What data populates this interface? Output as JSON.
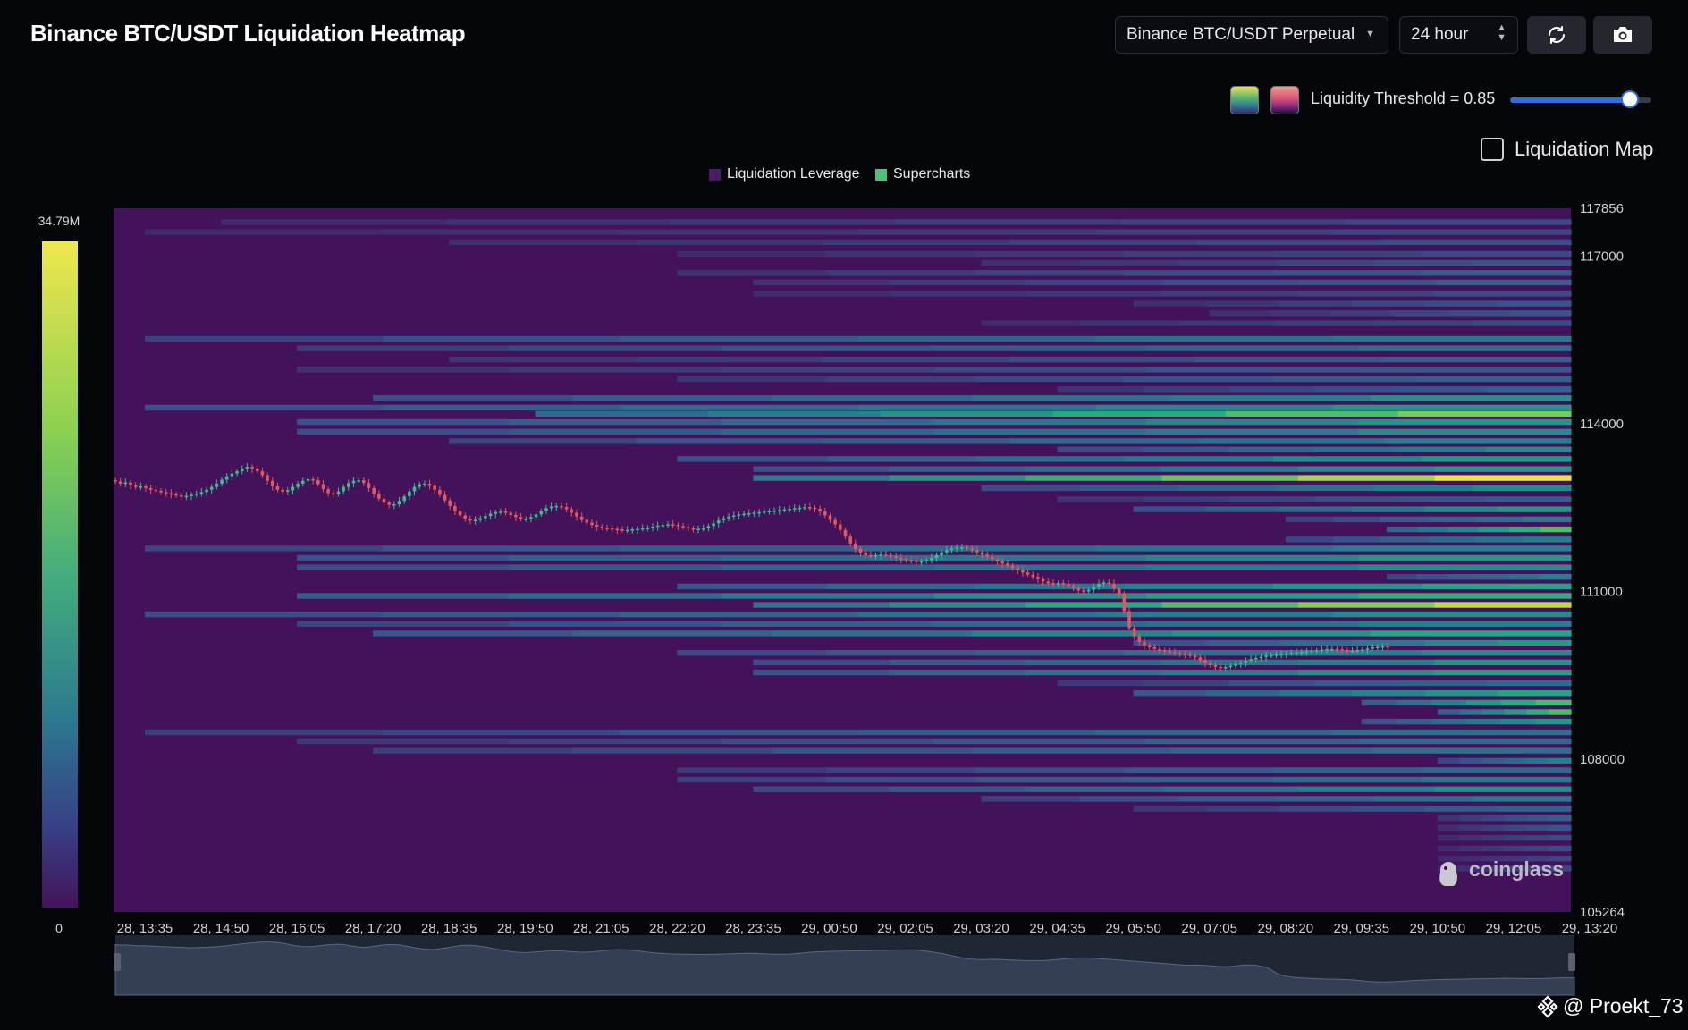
{
  "header": {
    "title": "Binance BTC/USDT Liquidation Heatmap",
    "pair_select": "Binance BTC/USDT Perpetual",
    "range_select": "24 hour"
  },
  "controls": {
    "threshold_label": "Liquidity Threshold = 0.85",
    "threshold_value": 0.85,
    "liquidation_map_label": "Liquidation Map",
    "liquidation_map_checked": false,
    "palettes": [
      "viridis",
      "magma"
    ]
  },
  "colors": {
    "background": "#05060a",
    "heatmap_base": "#43125a",
    "up_candle": "#3dbd8e",
    "down_candle": "#e5575e",
    "accent": "#2f6fe0"
  },
  "colorbar": {
    "max_label": "34.79M",
    "min_label": "0"
  },
  "watermark": {
    "brand": "coinglass",
    "handle": "@ Proekt_73"
  },
  "chart_data": {
    "type": "heatmap",
    "title": "Binance BTC/USDT Liquidation Heatmap",
    "legend": [
      "Liquidation Leverage",
      "Supercharts"
    ],
    "legend_placement": "top-center",
    "x_ticks": [
      "28, 13:35",
      "28, 14:50",
      "28, 16:05",
      "28, 17:20",
      "28, 18:35",
      "28, 19:50",
      "28, 21:05",
      "28, 22:20",
      "28, 23:35",
      "29, 00:50",
      "29, 02:05",
      "29, 03:20",
      "29, 04:35",
      "29, 05:50",
      "29, 07:05",
      "29, 08:20",
      "29, 09:35",
      "29, 10:50",
      "29, 12:05",
      "29, 13:20"
    ],
    "y_ticks": [
      117856,
      117000,
      114000,
      111000,
      108000,
      105264
    ],
    "ylim": [
      105264,
      117856
    ],
    "xlim": [
      "28, 13:35",
      "29, 13:45"
    ],
    "colorbar_range": [
      0,
      34.79
    ],
    "colorbar_unit": "M",
    "price_series": {
      "interval_minutes": 5,
      "close": [
        112970,
        112930,
        112950,
        112900,
        112870,
        112880,
        112850,
        112820,
        112800,
        112780,
        112760,
        112740,
        112720,
        112700,
        112710,
        112730,
        112750,
        112780,
        112820,
        112870,
        112930,
        113000,
        113060,
        113110,
        113150,
        113200,
        113230,
        113200,
        113150,
        113080,
        112980,
        112880,
        112820,
        112790,
        112810,
        112870,
        112930,
        112980,
        113010,
        112990,
        112920,
        112830,
        112760,
        112740,
        112790,
        112870,
        112940,
        112980,
        112990,
        112940,
        112850,
        112750,
        112660,
        112590,
        112550,
        112560,
        112620,
        112700,
        112790,
        112870,
        112920,
        112930,
        112890,
        112820,
        112730,
        112630,
        112530,
        112440,
        112360,
        112300,
        112270,
        112280,
        112310,
        112350,
        112390,
        112420,
        112430,
        112410,
        112370,
        112330,
        112300,
        112300,
        112330,
        112380,
        112440,
        112490,
        112520,
        112530,
        112510,
        112470,
        112410,
        112340,
        112280,
        112230,
        112190,
        112160,
        112140,
        112130,
        112120,
        112110,
        112100,
        112100,
        112110,
        112120,
        112130,
        112140,
        112160,
        112180,
        112190,
        112200,
        112190,
        112170,
        112150,
        112130,
        112120,
        112120,
        112130,
        112170,
        112220,
        112270,
        112310,
        112340,
        112360,
        112380,
        112390,
        112400,
        112410,
        112420,
        112430,
        112440,
        112450,
        112460,
        112470,
        112480,
        112490,
        112500,
        112510,
        112500,
        112480,
        112430,
        112360,
        112280,
        112200,
        112100,
        111980,
        111860,
        111760,
        111690,
        111650,
        111640,
        111650,
        111660,
        111650,
        111630,
        111600,
        111580,
        111560,
        111550,
        111540,
        111540,
        111560,
        111600,
        111650,
        111700,
        111740,
        111770,
        111790,
        111790,
        111770,
        111740,
        111700,
        111660,
        111620,
        111580,
        111540,
        111500,
        111460,
        111420,
        111380,
        111340,
        111300,
        111260,
        111220,
        111180,
        111150,
        111140,
        111150,
        111130,
        111100,
        111060,
        111020,
        111000,
        111030,
        111090,
        111140,
        111160,
        111140,
        111050,
        110950,
        110650,
        110350,
        110200,
        110100,
        110040,
        110000,
        109970,
        109950,
        109930,
        109910,
        109900,
        109890,
        109870,
        109850,
        109820,
        109770,
        109720,
        109680,
        109650,
        109640,
        109650,
        109670,
        109700,
        109730,
        109760,
        109790,
        109810,
        109830,
        109850,
        109860,
        109870,
        109880,
        109890,
        109900,
        109910,
        109920,
        109930,
        109940,
        109950,
        109960,
        109970,
        109970,
        109960,
        109950,
        109940,
        109940,
        109950,
        109960,
        109980,
        110000,
        110010,
        110020,
        110010
      ]
    },
    "liquidation_bands": [
      {
        "price": 117610,
        "start": "28, 14:50",
        "intensity": 0.22
      },
      {
        "price": 117430,
        "start": "28, 13:35",
        "intensity": 0.2
      },
      {
        "price": 117250,
        "start": "28, 18:35",
        "intensity": 0.24
      },
      {
        "price": 117040,
        "start": "28, 22:20",
        "intensity": 0.22
      },
      {
        "price": 116880,
        "start": "29, 03:20",
        "intensity": 0.26
      },
      {
        "price": 116700,
        "start": "28, 22:20",
        "intensity": 0.3
      },
      {
        "price": 116530,
        "start": "28, 23:35",
        "intensity": 0.3
      },
      {
        "price": 116330,
        "start": "28, 23:35",
        "intensity": 0.22
      },
      {
        "price": 116150,
        "start": "29, 05:50",
        "intensity": 0.26
      },
      {
        "price": 115980,
        "start": "29, 07:05",
        "intensity": 0.26
      },
      {
        "price": 115800,
        "start": "29, 03:20",
        "intensity": 0.22
      },
      {
        "price": 115520,
        "start": "28, 13:35",
        "intensity": 0.42
      },
      {
        "price": 115350,
        "start": "28, 16:05",
        "intensity": 0.38
      },
      {
        "price": 115150,
        "start": "28, 18:35",
        "intensity": 0.3
      },
      {
        "price": 114970,
        "start": "28, 16:05",
        "intensity": 0.28
      },
      {
        "price": 114800,
        "start": "28, 22:20",
        "intensity": 0.32
      },
      {
        "price": 114620,
        "start": "29, 04:35",
        "intensity": 0.3
      },
      {
        "price": 114460,
        "start": "28, 17:20",
        "intensity": 0.52
      },
      {
        "price": 114290,
        "start": "28, 13:35",
        "intensity": 0.55
      },
      {
        "price": 114180,
        "start": "28, 20:00",
        "intensity": 0.8
      },
      {
        "price": 114030,
        "start": "28, 16:05",
        "intensity": 0.55
      },
      {
        "price": 113860,
        "start": "28, 16:05",
        "intensity": 0.5
      },
      {
        "price": 113690,
        "start": "28, 18:35",
        "intensity": 0.45
      },
      {
        "price": 113540,
        "start": "29, 04:35",
        "intensity": 0.5
      },
      {
        "price": 113370,
        "start": "28, 22:20",
        "intensity": 0.55
      },
      {
        "price": 113190,
        "start": "28, 23:35",
        "intensity": 0.55
      },
      {
        "price": 113030,
        "start": "28, 23:35",
        "intensity": 0.98
      },
      {
        "price": 112850,
        "start": "29, 03:20",
        "intensity": 0.5
      },
      {
        "price": 112650,
        "start": "29, 04:35",
        "intensity": 0.3
      },
      {
        "price": 112470,
        "start": "29, 05:50",
        "intensity": 0.55
      },
      {
        "price": 112290,
        "start": "29, 08:20",
        "intensity": 0.42
      },
      {
        "price": 112110,
        "start": "29, 10:00",
        "intensity": 0.72
      },
      {
        "price": 111930,
        "start": "29, 08:20",
        "intensity": 0.45
      },
      {
        "price": 111770,
        "start": "28, 13:35",
        "intensity": 0.45
      },
      {
        "price": 111600,
        "start": "28, 16:05",
        "intensity": 0.55
      },
      {
        "price": 111430,
        "start": "28, 16:05",
        "intensity": 0.5
      },
      {
        "price": 111260,
        "start": "29, 10:00",
        "intensity": 0.45
      },
      {
        "price": 111090,
        "start": "28, 22:20",
        "intensity": 0.6
      },
      {
        "price": 110920,
        "start": "28, 16:05",
        "intensity": 0.65
      },
      {
        "price": 110760,
        "start": "28, 23:35",
        "intensity": 0.92
      },
      {
        "price": 110590,
        "start": "28, 13:35",
        "intensity": 0.5
      },
      {
        "price": 110420,
        "start": "28, 16:05",
        "intensity": 0.45
      },
      {
        "price": 110250,
        "start": "28, 17:20",
        "intensity": 0.6
      },
      {
        "price": 110080,
        "start": "29, 05:50",
        "intensity": 0.55
      },
      {
        "price": 109900,
        "start": "28, 22:20",
        "intensity": 0.5
      },
      {
        "price": 109730,
        "start": "28, 23:35",
        "intensity": 0.52
      },
      {
        "price": 109550,
        "start": "28, 23:35",
        "intensity": 0.58
      },
      {
        "price": 109360,
        "start": "29, 04:35",
        "intensity": 0.35
      },
      {
        "price": 109180,
        "start": "29, 05:50",
        "intensity": 0.6
      },
      {
        "price": 109010,
        "start": "29, 09:35",
        "intensity": 0.7
      },
      {
        "price": 108840,
        "start": "29, 10:50",
        "intensity": 0.72
      },
      {
        "price": 108670,
        "start": "29, 09:35",
        "intensity": 0.55
      },
      {
        "price": 108480,
        "start": "28, 13:35",
        "intensity": 0.38
      },
      {
        "price": 108320,
        "start": "28, 16:05",
        "intensity": 0.35
      },
      {
        "price": 108150,
        "start": "28, 17:20",
        "intensity": 0.38
      },
      {
        "price": 107970,
        "start": "29, 10:50",
        "intensity": 0.45
      },
      {
        "price": 107800,
        "start": "28, 22:20",
        "intensity": 0.35
      },
      {
        "price": 107630,
        "start": "28, 22:20",
        "intensity": 0.42
      },
      {
        "price": 107460,
        "start": "28, 23:35",
        "intensity": 0.5
      },
      {
        "price": 107290,
        "start": "29, 03:20",
        "intensity": 0.42
      },
      {
        "price": 107110,
        "start": "29, 05:50",
        "intensity": 0.32
      },
      {
        "price": 106940,
        "start": "29, 10:50",
        "intensity": 0.3
      },
      {
        "price": 106770,
        "start": "29, 10:50",
        "intensity": 0.26
      },
      {
        "price": 106590,
        "start": "29, 10:50",
        "intensity": 0.22
      },
      {
        "price": 106400,
        "start": "29, 10:50",
        "intensity": 0.22
      },
      {
        "price": 106220,
        "start": "29, 10:50",
        "intensity": 0.2
      },
      {
        "price": 106040,
        "start": "29, 10:50",
        "intensity": 0.2
      }
    ]
  }
}
